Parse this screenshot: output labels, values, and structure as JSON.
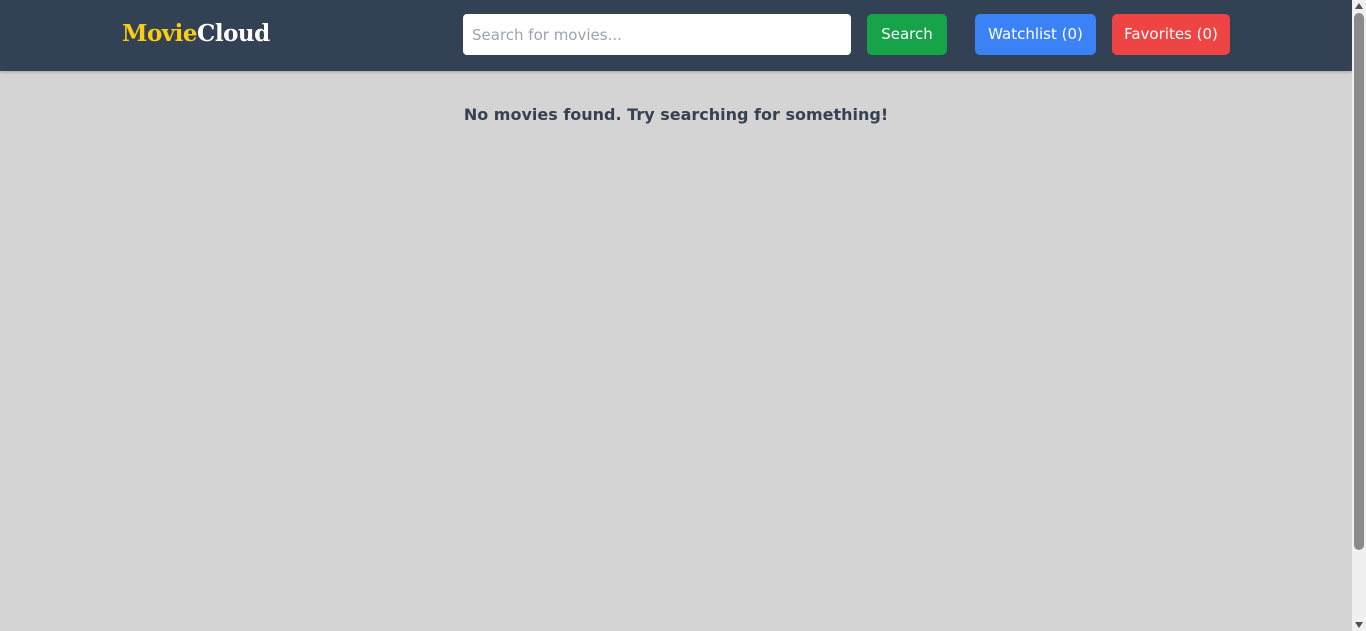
{
  "header": {
    "logo_part1": "Movie",
    "logo_part2": "Cloud",
    "search_placeholder": "Search for movies...",
    "search_value": "",
    "search_button": "Search",
    "watchlist_button": "Watchlist (0)",
    "favorites_button": "Favorites (0)"
  },
  "main": {
    "empty_message": "No movies found. Try searching for something!"
  },
  "colors": {
    "header_bg": "#334155",
    "page_bg": "#d4d4d4",
    "logo_accent": "#facc15",
    "search_button": "#16a34a",
    "watchlist_button": "#3b82f6",
    "favorites_button": "#ef4444"
  }
}
